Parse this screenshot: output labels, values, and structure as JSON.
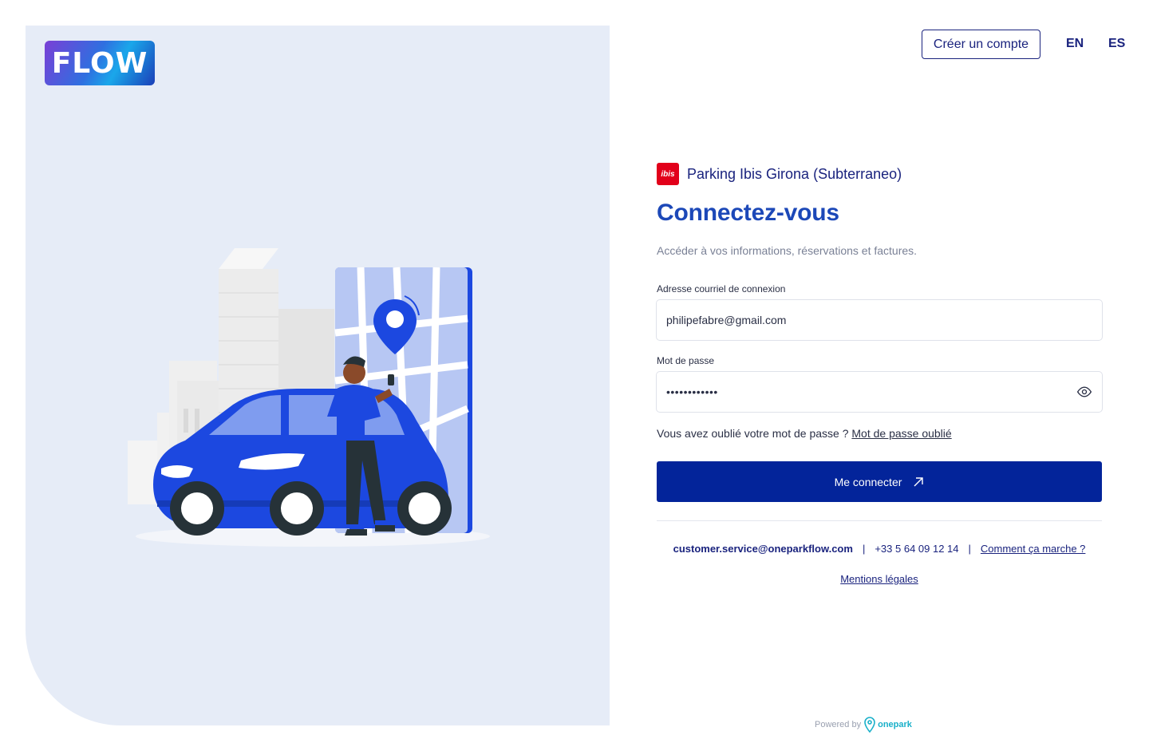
{
  "brand": {
    "logo_text": "FLOW"
  },
  "header": {
    "create_account": "Créer un compte",
    "languages": [
      "EN",
      "ES"
    ]
  },
  "parking": {
    "name": "Parking Ibis Girona (Subterraneo)",
    "logo_text": "ibis"
  },
  "form": {
    "title": "Connectez-vous",
    "subtitle": "Accéder à vos informations, réservations et factures.",
    "email_label": "Adresse courriel de connexion",
    "email_value": "philipefabre@gmail.com",
    "password_label": "Mot de passe",
    "password_value": "••••••••••••",
    "forgot_text": "Vous avez oublié votre mot de passe ? ",
    "forgot_link": "Mot de passe oublié",
    "submit_label": "Me connecter"
  },
  "footer": {
    "email": "customer.service@oneparkflow.com",
    "separator": "|",
    "phone": "+33 5 64 09 12 14",
    "how_it_works": "Comment ça marche ?",
    "legal": "Mentions légales",
    "powered_by": "Powered by",
    "powered_brand": "onepark"
  },
  "colors": {
    "primary": "#03249a",
    "title": "#1c48b8",
    "panel": "#e6ecf7",
    "ibis_red": "#e2001a"
  }
}
